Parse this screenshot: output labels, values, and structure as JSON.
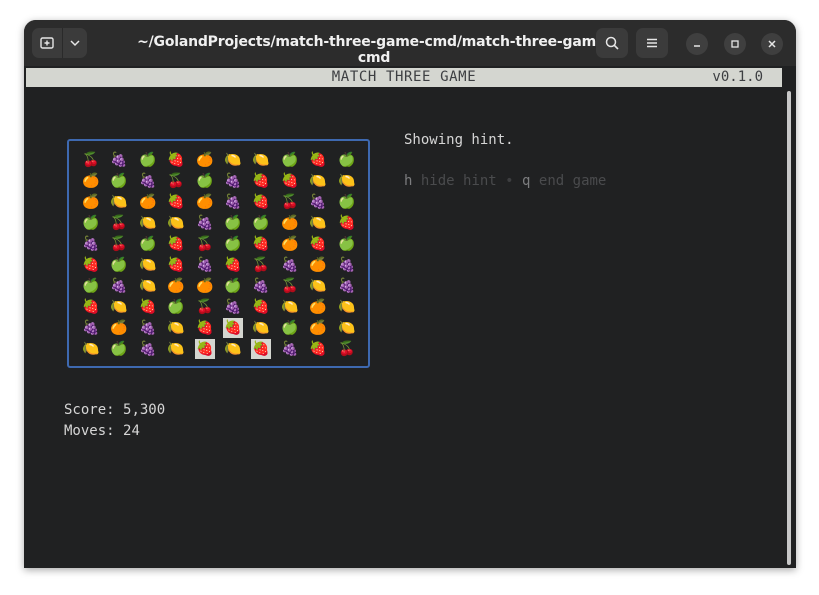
{
  "window": {
    "title": "~/GolandProjects/match-three-game-cmd/match-three-game-cmd"
  },
  "icons": {
    "new_tab": "new-tab-icon",
    "dropdown": "chevron-down-icon",
    "search": "search-icon",
    "menu": "hamburger-menu-icon",
    "minimize": "minimize-icon",
    "maximize": "maximize-icon",
    "close": "close-icon"
  },
  "header": {
    "title": "MATCH THREE GAME",
    "version": "v0.1.0"
  },
  "status": {
    "message": "Showing hint."
  },
  "help": {
    "hide_key": "h",
    "hide_label": "hide hint",
    "separator": "•",
    "quit_key": "q",
    "quit_label": "end game"
  },
  "stats": {
    "score_label": "Score:",
    "score_value": "5,300",
    "moves_label": "Moves:",
    "moves_value": "24"
  },
  "board": {
    "rows": [
      [
        "🍒",
        "🍇",
        "🍏",
        "🍓",
        "🍊",
        "🍋",
        "🍋",
        "🍏",
        "🍓",
        "🍏"
      ],
      [
        "🍊",
        "🍏",
        "🍇",
        "🍒",
        "🍏",
        "🍇",
        "🍓",
        "🍓",
        "🍋",
        "🍋"
      ],
      [
        "🍊",
        "🍋",
        "🍊",
        "🍓",
        "🍊",
        "🍇",
        "🍓",
        "🍒",
        "🍇",
        "🍏"
      ],
      [
        "🍏",
        "🍒",
        "🍋",
        "🍋",
        "🍇",
        "🍏",
        "🍏",
        "🍊",
        "🍋",
        "🍓"
      ],
      [
        "🍇",
        "🍒",
        "🍏",
        "🍓",
        "🍒",
        "🍏",
        "🍓",
        "🍊",
        "🍓",
        "🍏"
      ],
      [
        "🍓",
        "🍏",
        "🍋",
        "🍓",
        "🍇",
        "🍓",
        "🍒",
        "🍇",
        "🍊",
        "🍇"
      ],
      [
        "🍏",
        "🍇",
        "🍋",
        "🍊",
        "🍊",
        "🍏",
        "🍇",
        "🍒",
        "🍋",
        "🍇"
      ],
      [
        "🍓",
        "🍋",
        "🍓",
        "🍏",
        "🍒",
        "🍇",
        "🍓",
        "🍋",
        "🍊",
        "🍋"
      ],
      [
        "🍇",
        "🍊",
        "🍇",
        "🍋",
        "🍓",
        "🍓",
        "🍋",
        "🍏",
        "🍊",
        "🍋"
      ],
      [
        "🍋",
        "🍏",
        "🍇",
        "🍋",
        "🍓",
        "🍋",
        "🍓",
        "🍇",
        "🍓",
        "🍒"
      ]
    ],
    "hint_cells": [
      [
        8,
        5
      ],
      [
        9,
        4
      ],
      [
        9,
        6
      ]
    ]
  }
}
